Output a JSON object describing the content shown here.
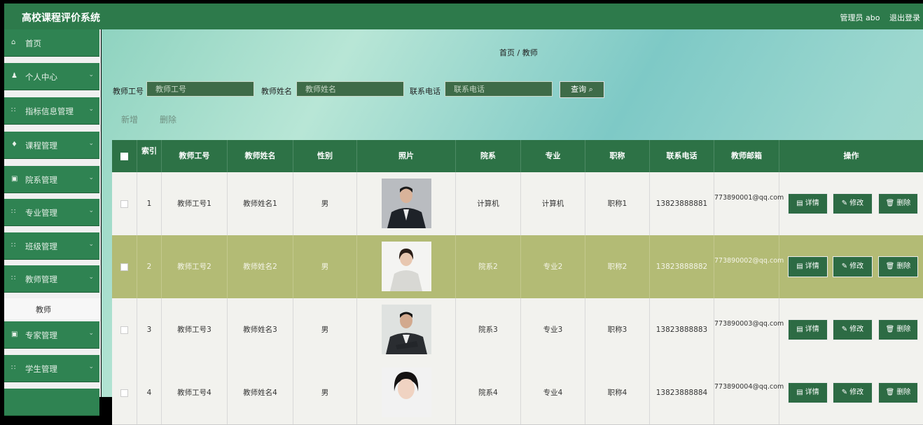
{
  "app": {
    "title": "高校课程评价系统"
  },
  "header": {
    "user": "管理员 abo",
    "logout": "退出登录"
  },
  "sidebar": {
    "items": [
      {
        "icon": "⌂",
        "label": "首页",
        "chev": ""
      },
      {
        "icon": "♟",
        "label": "个人中心",
        "chev": "⌄"
      },
      {
        "icon": "∷",
        "label": "指标信息管理",
        "chev": "⌄"
      },
      {
        "icon": "♦",
        "label": "课程管理",
        "chev": "⌄"
      },
      {
        "icon": "▣",
        "label": "院系管理",
        "chev": "⌄"
      },
      {
        "icon": "∷",
        "label": "专业管理",
        "chev": "⌄"
      },
      {
        "icon": "∷",
        "label": "班级管理",
        "chev": "⌄"
      },
      {
        "icon": "∷",
        "label": "教师管理",
        "chev": "⌄"
      }
    ],
    "sub": "教师",
    "after": [
      {
        "icon": "▣",
        "label": "专家管理",
        "chev": "⌄"
      },
      {
        "icon": "∷",
        "label": "学生管理",
        "chev": "⌄"
      }
    ]
  },
  "breadcrumb": "首页 / 教师",
  "search": {
    "f1_label": "教师工号",
    "f1_ph": "教师工号",
    "f2_label": "教师姓名",
    "f2_ph": "教师姓名",
    "f3_label": "联系电话",
    "f3_ph": "联系电话",
    "btn": "查询 ⌕"
  },
  "actions": {
    "add": "新增",
    "del": "删除"
  },
  "table": {
    "headers": [
      "",
      "索引",
      "教师工号",
      "教师姓名",
      "性别",
      "照片",
      "院系",
      "专业",
      "职称",
      "联系电话",
      "教师邮箱",
      "操作"
    ],
    "rows": [
      {
        "idx": "1",
        "no": "教师工号1",
        "name": "教师姓名1",
        "sex": "男",
        "dept": "计算机",
        "major": "计算机",
        "title": "职称1",
        "phone": "13823888881",
        "email": "773890001@qq.com"
      },
      {
        "idx": "2",
        "no": "教师工号2",
        "name": "教师姓名2",
        "sex": "男",
        "dept": "院系2",
        "major": "专业2",
        "title": "职称2",
        "phone": "13823888882",
        "email": "773890002@qq.com"
      },
      {
        "idx": "3",
        "no": "教师工号3",
        "name": "教师姓名3",
        "sex": "男",
        "dept": "院系3",
        "major": "专业3",
        "title": "职称3",
        "phone": "13823888883",
        "email": "773890003@qq.com"
      },
      {
        "idx": "4",
        "no": "教师工号4",
        "name": "教师姓名4",
        "sex": "男",
        "dept": "院系4",
        "major": "专业4",
        "title": "职称4",
        "phone": "13823888884",
        "email": "773890004@qq.com"
      }
    ],
    "ops": {
      "detail": "详情",
      "edit": "修改",
      "del": "删除"
    }
  }
}
